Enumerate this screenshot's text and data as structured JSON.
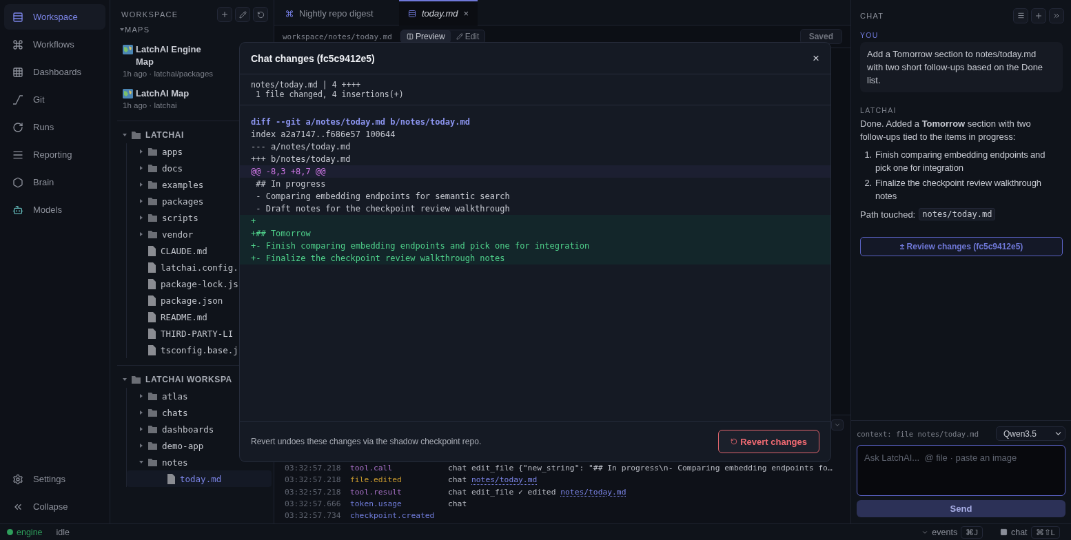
{
  "nav": {
    "items": [
      {
        "label": "Workspace",
        "selected": true
      },
      {
        "label": "Workflows",
        "selected": false
      },
      {
        "label": "Dashboards",
        "selected": false
      },
      {
        "label": "Git",
        "selected": false
      },
      {
        "label": "Runs",
        "selected": false
      },
      {
        "label": "Reporting",
        "selected": false
      },
      {
        "label": "Brain",
        "selected": false
      },
      {
        "label": "Models",
        "selected": false
      }
    ],
    "footer": [
      {
        "label": "Settings"
      },
      {
        "label": "Collapse"
      }
    ]
  },
  "explorer": {
    "title": "WORKSPACE",
    "maps_heading": "MAPS",
    "maps": [
      {
        "title": "LatchAI Engine Map",
        "meta": "1h ago · latchai/packages"
      },
      {
        "title": "LatchAI Map",
        "meta": "1h ago · latchai"
      }
    ],
    "trees": [
      {
        "label": "LATCHAI",
        "expanded": true,
        "children": [
          {
            "label": "apps",
            "kind": "folder",
            "expanded": false,
            "selected": false
          },
          {
            "label": "docs",
            "kind": "folder",
            "expanded": false,
            "selected": false
          },
          {
            "label": "examples",
            "kind": "folder",
            "expanded": false,
            "selected": false
          },
          {
            "label": "packages",
            "kind": "folder",
            "expanded": false,
            "selected": false
          },
          {
            "label": "scripts",
            "kind": "folder",
            "expanded": false,
            "selected": false
          },
          {
            "label": "vendor",
            "kind": "folder",
            "expanded": false,
            "selected": false
          },
          {
            "label": "CLAUDE.md",
            "kind": "file",
            "selected": false
          },
          {
            "label": "latchai.config.",
            "kind": "file",
            "selected": false
          },
          {
            "label": "package-lock.js",
            "kind": "file",
            "selected": false
          },
          {
            "label": "package.json",
            "kind": "file",
            "selected": false
          },
          {
            "label": "README.md",
            "kind": "file",
            "selected": false
          },
          {
            "label": "THIRD-PARTY-LI",
            "kind": "file",
            "selected": false
          },
          {
            "label": "tsconfig.base.j",
            "kind": "file",
            "selected": false
          }
        ]
      },
      {
        "label": "LATCHAI WORKSPA",
        "expanded": true,
        "children": [
          {
            "label": "atlas",
            "kind": "folder",
            "expanded": false,
            "selected": false
          },
          {
            "label": "chats",
            "kind": "folder",
            "expanded": false,
            "selected": false
          },
          {
            "label": "dashboards",
            "kind": "folder",
            "expanded": false,
            "selected": false
          },
          {
            "label": "demo-app",
            "kind": "folder",
            "expanded": false,
            "selected": false
          },
          {
            "label": "notes",
            "kind": "folder",
            "expanded": true,
            "selected": false,
            "children": [
              {
                "label": "today.md",
                "kind": "file",
                "selected": true
              }
            ]
          }
        ]
      }
    ]
  },
  "editor": {
    "tabs": [
      {
        "label": "Nightly repo digest",
        "selected": false
      },
      {
        "label": "today.md",
        "selected": true,
        "close": "×"
      }
    ],
    "path": "workspace/notes/today.md",
    "views": [
      {
        "label": "Preview",
        "selected": true
      },
      {
        "label": "Edit",
        "selected": false
      }
    ],
    "save_status": "Saved",
    "events": [
      {
        "time": "03:32:57.218",
        "type": "tool.call",
        "color": "#a66fc4",
        "detail": [
          {
            "kind": "text",
            "text": "chat edit_file {\"new_string\": \"## In progress\\n- Comparing embedding endpoints fo…"
          }
        ]
      },
      {
        "time": "03:32:57.218",
        "type": "file.edited",
        "color": "#c99a2e",
        "detail": [
          {
            "kind": "text",
            "text": "chat "
          },
          {
            "kind": "link",
            "text": "notes/today.md"
          }
        ]
      },
      {
        "time": "03:32:57.218",
        "type": "tool.result",
        "color": "#a66fc4",
        "detail": [
          {
            "kind": "text",
            "text": "chat edit_file ✓ edited "
          },
          {
            "kind": "link",
            "text": "notes/today.md"
          }
        ]
      },
      {
        "time": "03:32:57.666",
        "type": "token.usage",
        "color": "#6f7bd8",
        "detail": [
          {
            "kind": "text",
            "text": "chat"
          }
        ]
      },
      {
        "time": "03:32:57.734",
        "type": "checkpoint.created",
        "color": "#6f7bd8"
      }
    ]
  },
  "modal": {
    "title": "Chat changes (fc5c9412e5)",
    "close": "×",
    "stat": [
      "notes/today.md | 4 ++++",
      " 1 file changed, 4 insertions(+)"
    ],
    "diff": [
      {
        "kind": "header",
        "text": "diff --git a/notes/today.md b/notes/today.md"
      },
      {
        "kind": "meta",
        "text": "index a2a7147..f686e57 100644"
      },
      {
        "kind": "meta",
        "text": "--- a/notes/today.md"
      },
      {
        "kind": "meta",
        "text": "+++ b/notes/today.md"
      },
      {
        "kind": "hunk",
        "text": "@@ -8,3 +8,7 @@"
      },
      {
        "kind": "context",
        "text": " ## In progress"
      },
      {
        "kind": "context",
        "text": " - Comparing embedding endpoints for semantic search"
      },
      {
        "kind": "context",
        "text": " - Draft notes for the checkpoint review walkthrough"
      },
      {
        "kind": "add",
        "text": "+"
      },
      {
        "kind": "add",
        "text": "+## Tomorrow"
      },
      {
        "kind": "add",
        "text": "+- Finish comparing embedding endpoints and pick one for integration"
      },
      {
        "kind": "add",
        "text": "+- Finalize the checkpoint review walkthrough notes"
      }
    ],
    "note": "Revert undoes these changes via the shadow checkpoint repo.",
    "revert": "Revert changes"
  },
  "chat": {
    "title": "CHAT",
    "user_label": "YOU",
    "user_message": "Add a Tomorrow section to notes/today.md with two short follow-ups based on the Done list.",
    "bot_label": "LATCHAI",
    "reply": "Done. Added a **Tomorrow** section with two follow-ups tied to the items in progress:",
    "list": [
      {
        "number": "1.",
        "text": "Finish comparing embedding endpoints and pick one for integration"
      },
      {
        "number": "2.",
        "text": "Finalize the checkpoint review walkthrough notes"
      }
    ],
    "path_label": "Path touched:",
    "path": "notes/today.md",
    "review": "± Review changes (fc5c9412e5)",
    "context": "context: file notes/today.md",
    "model": "Qwen3.5",
    "placeholder": "Ask LatchAI...  @ file · paste an image",
    "send": "Send"
  },
  "status": {
    "engine": "engine",
    "engine_on": true,
    "state": "idle",
    "events": "events",
    "events_key": "⌘J",
    "chat": "chat",
    "chat_key": "⌘⇧L"
  }
}
